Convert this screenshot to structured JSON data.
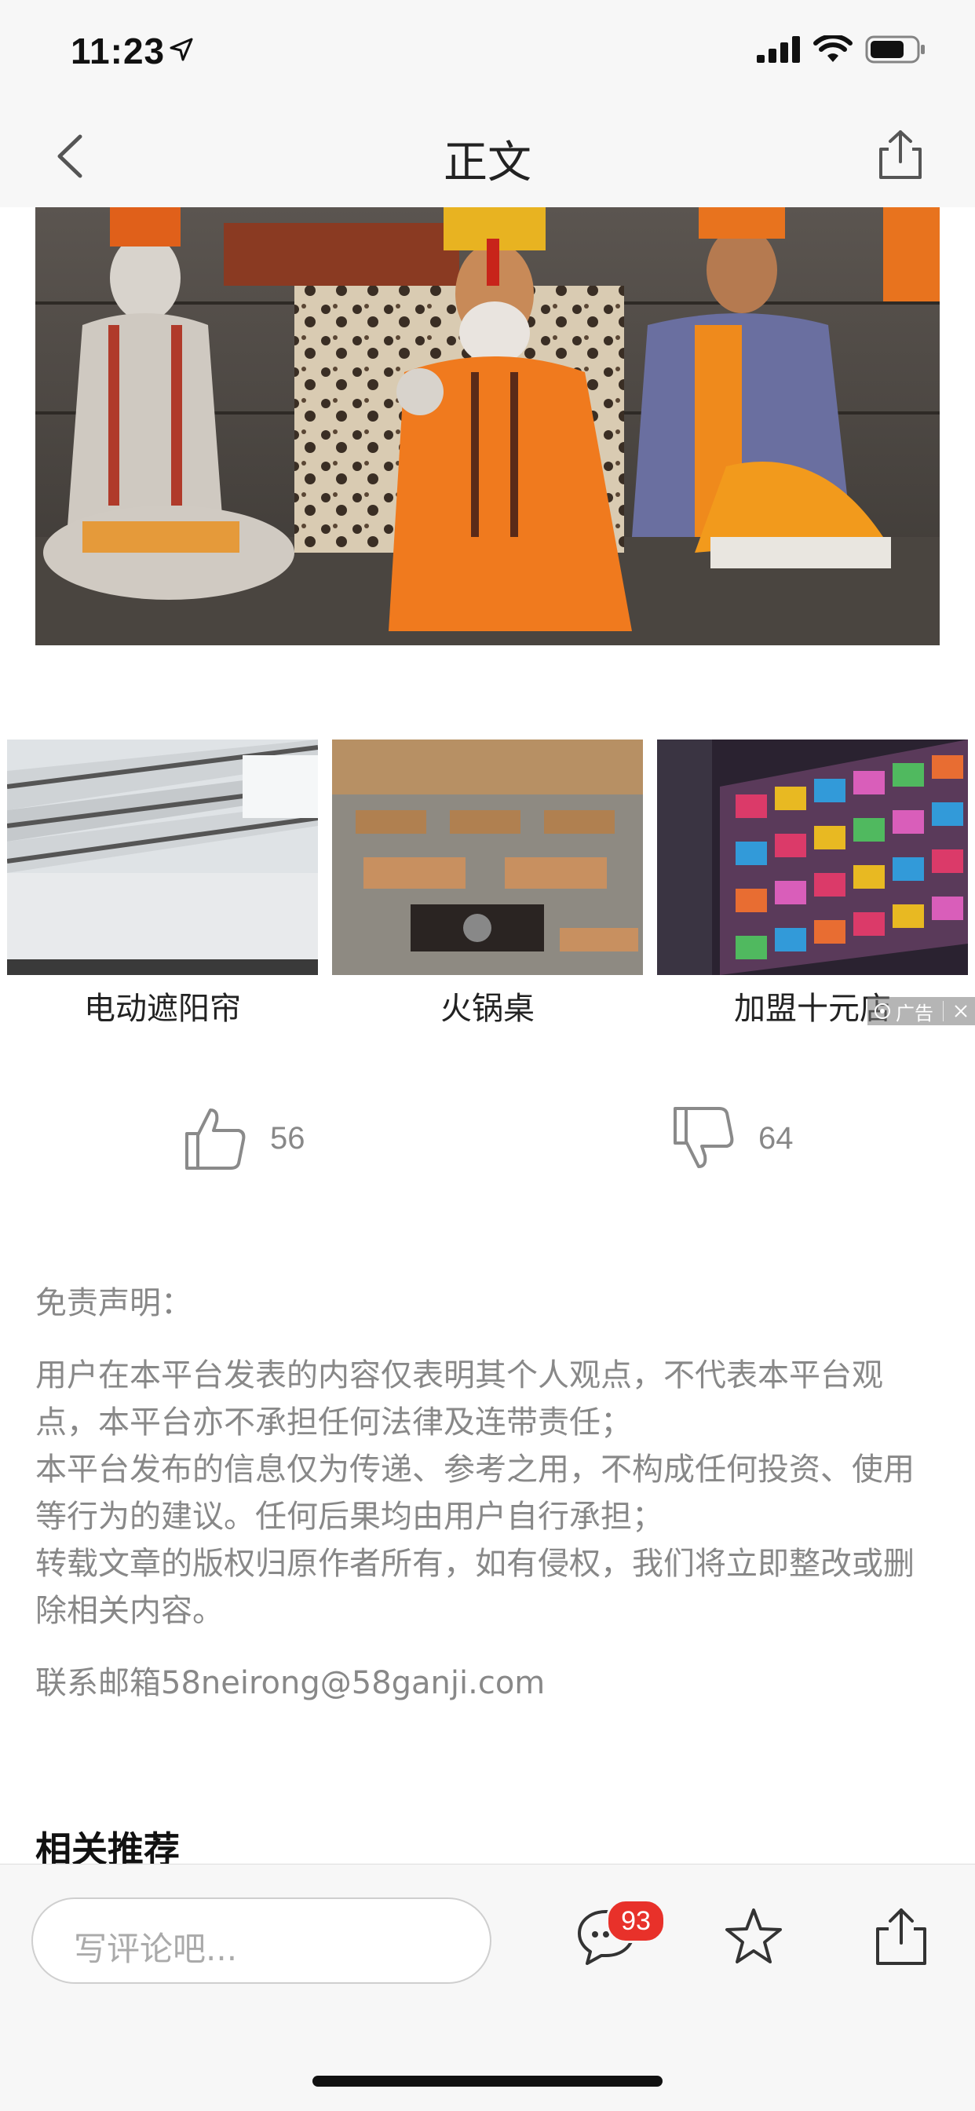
{
  "status_bar": {
    "time": "11:23"
  },
  "nav": {
    "title": "正文"
  },
  "ads": {
    "items": [
      {
        "label": "电动遮阳帘"
      },
      {
        "label": "火锅桌"
      },
      {
        "label": "加盟十元店"
      }
    ],
    "badge_label": "广告"
  },
  "votes": {
    "likes": "56",
    "dislikes": "64"
  },
  "disclaimer": {
    "title": "免责声明：",
    "paragraph1": "用户在本平台发表的内容仅表明其个人观点，不代表本平台观点，本平台亦不承担任何法律及连带责任；",
    "paragraph2": "本平台发布的信息仅为传递、参考之用，不构成任何投资、使用等行为的建议。任何后果均由用户自行承担；",
    "paragraph3": "转载文章的版权归原作者所有，如有侵权，我们将立即整改或删除相关内容。",
    "contact": "联系邮箱58neirong@58ganji.com"
  },
  "related": {
    "title": "相关推荐"
  },
  "bottom_bar": {
    "comment_placeholder": "写评论吧...",
    "comment_count": "93"
  },
  "colors": {
    "badge_red": "#e8312a",
    "hero_orange": "#f07a1e"
  }
}
